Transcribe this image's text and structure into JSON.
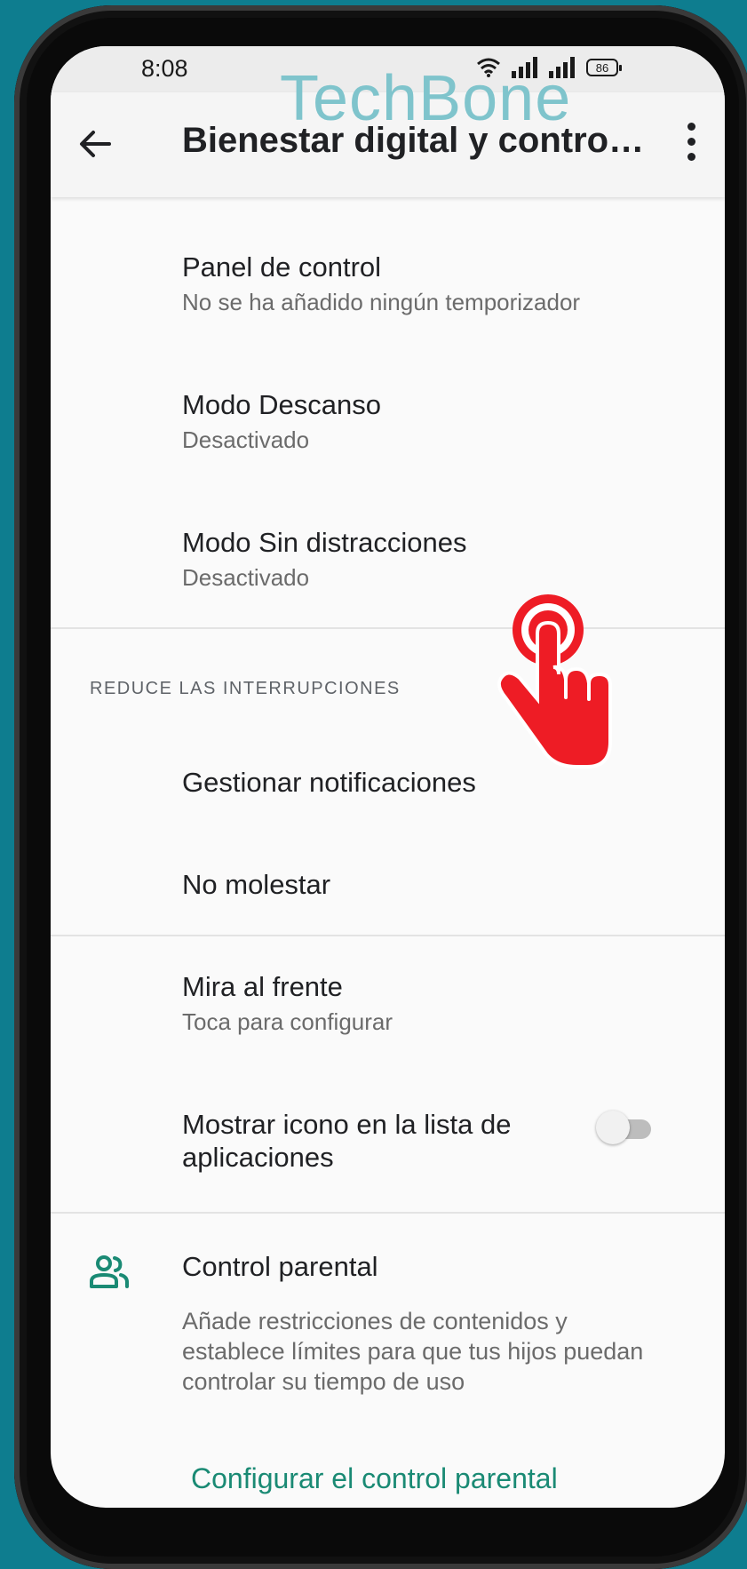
{
  "status_bar": {
    "time": "8:08",
    "battery": "86"
  },
  "watermark": "TechBone",
  "app_bar": {
    "title": "Bienestar digital y contro…"
  },
  "items": {
    "panel": {
      "title": "Panel de control",
      "subtitle": "No se ha añadido ningún temporizador"
    },
    "descanso": {
      "title": "Modo Descanso",
      "subtitle": "Desactivado"
    },
    "sin_distracciones": {
      "title": "Modo Sin distracciones",
      "subtitle": "Desactivado"
    },
    "section_header": "REDUCE LAS INTERRUPCIONES",
    "notificaciones": {
      "title": "Gestionar notificaciones"
    },
    "no_molestar": {
      "title": "No molestar"
    },
    "mira_frente": {
      "title": "Mira al frente",
      "subtitle": "Toca para configurar"
    },
    "mostrar_icono": {
      "line1": "Mostrar icono en la lista de",
      "line2": "aplicaciones",
      "toggle_on": false
    },
    "parental": {
      "title": "Control parental",
      "description": "Añade restricciones de contenidos y establece límites para que tus hijos puedan controlar su tiempo de uso",
      "link": "Configurar el control parental"
    }
  },
  "colors": {
    "accent": "#1a8a74",
    "tap_indicator": "#ee1c25",
    "background": "#0e7d8f"
  }
}
